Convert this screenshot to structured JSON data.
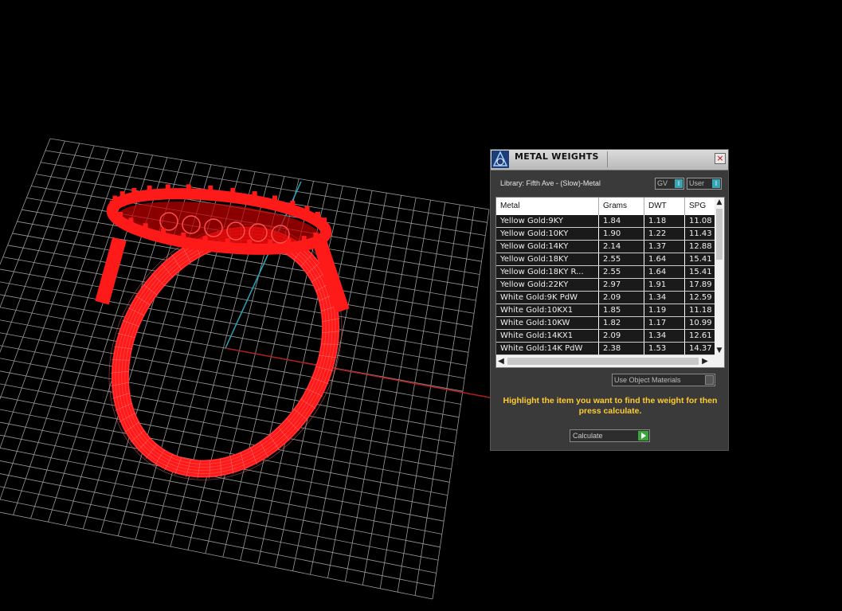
{
  "panel": {
    "title": "METAL WEIGHTS",
    "close_glyph": "×",
    "library_label": "Library: Fifth Ave - (Slow)-Metal",
    "gv_label": "GV",
    "user_label": "User",
    "use_object_materials": "Use Object Materials",
    "hint": "Highlight the item you want to find the weight for then press calculate.",
    "calculate_label": "Calculate",
    "icons": {
      "title": "cad-logo-icon",
      "close": "close-icon",
      "calculate": "play-icon"
    },
    "accent_color": "#ffcc33"
  },
  "table": {
    "columns": [
      "Metal",
      "Grams",
      "DWT",
      "SPG"
    ],
    "rows": [
      {
        "metal": "Yellow Gold:9KY",
        "grams": "1.84",
        "dwt": "1.18",
        "spg": "11.08"
      },
      {
        "metal": "Yellow Gold:10KY",
        "grams": "1.90",
        "dwt": "1.22",
        "spg": "11.43"
      },
      {
        "metal": "Yellow Gold:14KY",
        "grams": "2.14",
        "dwt": "1.37",
        "spg": "12.88"
      },
      {
        "metal": "Yellow Gold:18KY",
        "grams": "2.55",
        "dwt": "1.64",
        "spg": "15.41"
      },
      {
        "metal": "Yellow Gold:18KY R...",
        "grams": "2.55",
        "dwt": "1.64",
        "spg": "15.41"
      },
      {
        "metal": "Yellow Gold:22KY",
        "grams": "2.97",
        "dwt": "1.91",
        "spg": "17.89"
      },
      {
        "metal": "White Gold:9K PdW",
        "grams": "2.09",
        "dwt": "1.34",
        "spg": "12.59"
      },
      {
        "metal": "White Gold:10KX1",
        "grams": "1.85",
        "dwt": "1.19",
        "spg": "11.18"
      },
      {
        "metal": "White Gold:10KW",
        "grams": "1.82",
        "dwt": "1.17",
        "spg": "10.99"
      },
      {
        "metal": "White Gold:14KX1",
        "grams": "2.09",
        "dwt": "1.34",
        "spg": "12.61"
      },
      {
        "metal": "White Gold:14K PdW",
        "grams": "2.38",
        "dwt": "1.53",
        "spg": "14.37"
      }
    ]
  },
  "viewport": {
    "model_color": "#ff1a1a",
    "grid_color": "#9a9a9a",
    "axis_colors": {
      "x": "#cc2222",
      "y": "#2aa6b8"
    }
  }
}
